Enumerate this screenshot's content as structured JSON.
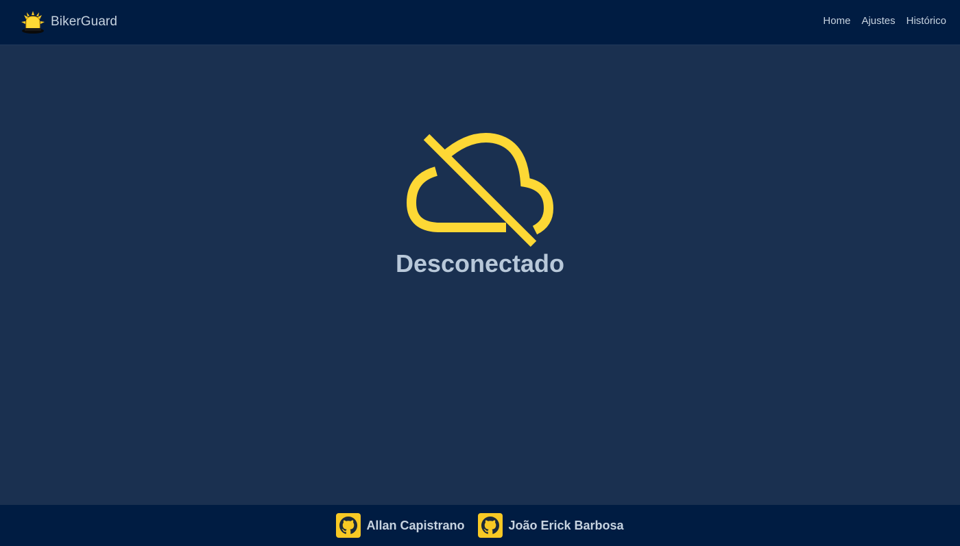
{
  "app": {
    "brand_name": "BikerGuard",
    "accent_color": "#fdd835",
    "header_bg": "#001c42",
    "main_bg": "#1a3050"
  },
  "nav": {
    "items": [
      {
        "label": "Home"
      },
      {
        "label": "Ajustes"
      },
      {
        "label": "Histórico"
      }
    ]
  },
  "status": {
    "icon": "cloud-off-icon",
    "label": "Desconectado"
  },
  "footer": {
    "authors": [
      {
        "name": "Allan Capistrano",
        "icon": "github-icon"
      },
      {
        "name": "João Erick Barbosa",
        "icon": "github-icon"
      }
    ]
  }
}
